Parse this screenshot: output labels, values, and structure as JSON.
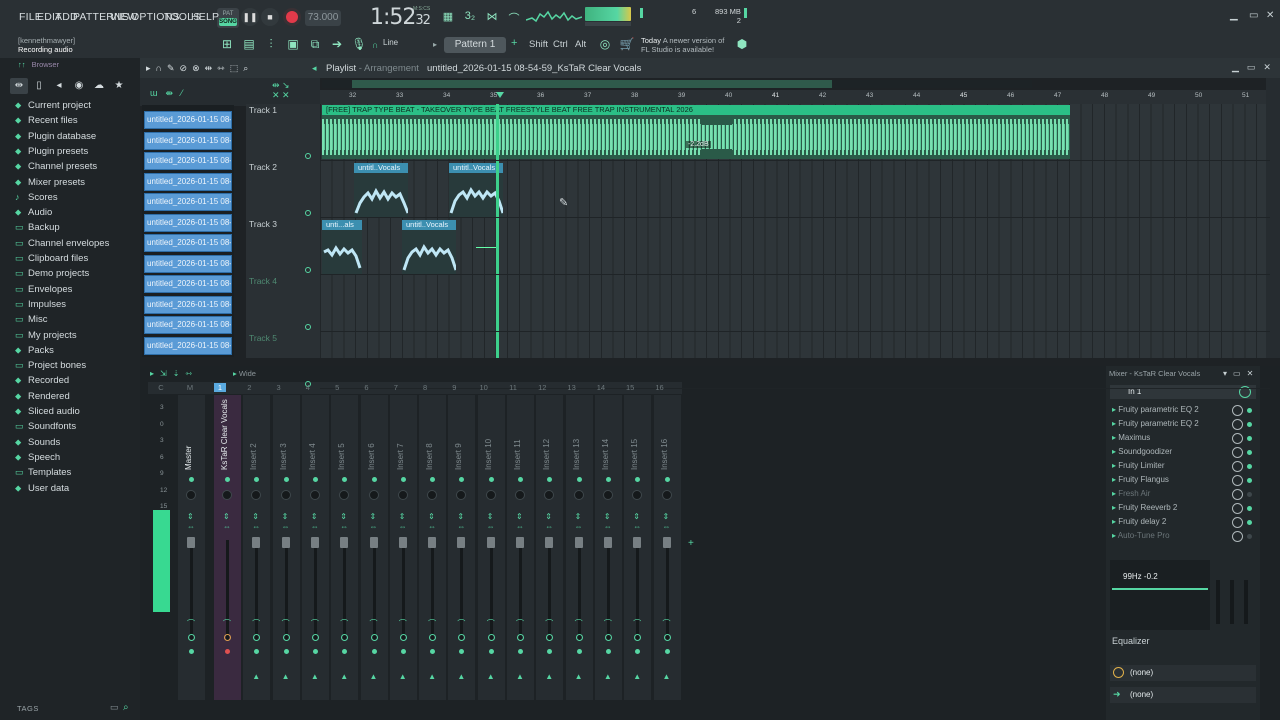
{
  "menu": [
    "FILE",
    "EDIT",
    "ADD",
    "PATTERNS",
    "VIEW",
    "OPTIONS",
    "TOOLS",
    "HELP"
  ],
  "transport": {
    "pat": "PAT",
    "song": "SONG",
    "tempo": "73.000",
    "time": "1:52",
    "time_small": "32",
    "time_unit": "M:S:CS"
  },
  "perf": {
    "cpu": "6",
    "mem": "893 MB",
    "voices": "2"
  },
  "hint": {
    "user": "[kennethmawyer]",
    "text": "Recording audio"
  },
  "snap": "Line",
  "pattern": "Pattern 1",
  "modifiers": [
    "Shift",
    "Ctrl",
    "Alt"
  ],
  "news": {
    "date": "Today",
    "text1": "A newer version of",
    "text2": "FL Studio is available!"
  },
  "browser": {
    "title": "Browser",
    "items": [
      {
        "icon": "home-icon",
        "glyph": "⬥",
        "label": "Current project"
      },
      {
        "icon": "clock-icon",
        "glyph": "⬥",
        "label": "Recent files"
      },
      {
        "icon": "plugin-icon",
        "glyph": "⬥",
        "label": "Plugin database"
      },
      {
        "icon": "plugin-icon",
        "glyph": "⬥",
        "label": "Plugin presets"
      },
      {
        "icon": "plugin-icon",
        "glyph": "⬥",
        "label": "Channel presets"
      },
      {
        "icon": "mixer-icon",
        "glyph": "⬥",
        "label": "Mixer presets"
      },
      {
        "icon": "note-icon",
        "glyph": "♪",
        "label": "Scores"
      },
      {
        "icon": "audio-icon",
        "glyph": "⬥",
        "label": "Audio"
      },
      {
        "icon": "folder-icon",
        "glyph": "▭",
        "label": "Backup"
      },
      {
        "icon": "folder-icon",
        "glyph": "▭",
        "label": "Channel envelopes"
      },
      {
        "icon": "folder-icon",
        "glyph": "▭",
        "label": "Clipboard files"
      },
      {
        "icon": "folder-icon",
        "glyph": "▭",
        "label": "Demo projects"
      },
      {
        "icon": "folder-icon",
        "glyph": "▭",
        "label": "Envelopes"
      },
      {
        "icon": "folder-icon",
        "glyph": "▭",
        "label": "Impulses"
      },
      {
        "icon": "folder-icon",
        "glyph": "▭",
        "label": "Misc"
      },
      {
        "icon": "folder-icon",
        "glyph": "▭",
        "label": "My projects"
      },
      {
        "icon": "packs-icon",
        "glyph": "⬥",
        "label": "Packs"
      },
      {
        "icon": "folder-icon",
        "glyph": "▭",
        "label": "Project bones"
      },
      {
        "icon": "recorded-icon",
        "glyph": "⬥",
        "label": "Recorded"
      },
      {
        "icon": "rendered-icon",
        "glyph": "⬥",
        "label": "Rendered"
      },
      {
        "icon": "sliced-icon",
        "glyph": "⬥",
        "label": "Sliced audio"
      },
      {
        "icon": "folder-icon",
        "glyph": "▭",
        "label": "Soundfonts"
      },
      {
        "icon": "sounds-icon",
        "glyph": "⬥",
        "label": "Sounds"
      },
      {
        "icon": "speech-icon",
        "glyph": "⬥",
        "label": "Speech"
      },
      {
        "icon": "folder-icon",
        "glyph": "▭",
        "label": "Templates"
      },
      {
        "icon": "userdata-icon",
        "glyph": "⬥",
        "label": "User data"
      }
    ],
    "tags": "TAGS"
  },
  "playlist": {
    "title": "Playlist",
    "sub": "Arrangement",
    "file": "untitled_2026-01-15 08-54-59_KsTaR Clear Vocals",
    "ruler": [
      "32",
      "33",
      "34",
      "35",
      "36",
      "37",
      "38",
      "39",
      "40",
      "41",
      "42",
      "43",
      "44",
      "45",
      "46",
      "47",
      "48",
      "49",
      "50",
      "51"
    ],
    "picker": [
      "untitled_2026-01-15 08-",
      "untitled_2026-01-15 08-",
      "untitled_2026-01-15 08-",
      "untitled_2026-01-15 08-",
      "untitled_2026-01-15 08-",
      "untitled_2026-01-15 08-",
      "untitled_2026-01-15 08-",
      "untitled_2026-01-15 08-",
      "untitled_2026-01-15 08-",
      "untitled_2026-01-15 08-",
      "untitled_2026-01-15 08-",
      "untitled_2026-01-15 08-"
    ],
    "tracks": [
      "Track 1",
      "Track 2",
      "Track 3",
      "Track 4",
      "Track 5"
    ],
    "clips": {
      "beat": "[FREE] TRAP TYPE BEAT - TAKEOVER  TYPE BEAT  FREESTYLE BEAT  FREE TRAP INSTRUMENTAL 2026",
      "c1": "untitl..Vocals",
      "c2": "untitl..Vocals",
      "c3": "unti...als",
      "c4": "untitl..Vocals"
    },
    "db": "-2.2dB"
  },
  "mixer": {
    "mode": "Wide",
    "numbers": [
      "C",
      "M",
      "1",
      "2",
      "3",
      "4",
      "5",
      "6",
      "7",
      "8",
      "9",
      "10",
      "11",
      "12",
      "13",
      "14",
      "15",
      "16"
    ],
    "strips": [
      "Master",
      "KsTaR Clear Vocals",
      "Insert 2",
      "Insert 3",
      "Insert 4",
      "Insert 5",
      "Insert 6",
      "Insert 7",
      "Insert 8",
      "Insert 9",
      "Insert 10",
      "Insert 11",
      "Insert 12",
      "Insert 13",
      "Insert 14",
      "Insert 15",
      "Insert 16"
    ],
    "db_scale": [
      "3",
      "0",
      "3",
      "6",
      "9",
      "12",
      "15"
    ]
  },
  "mixer_panel": {
    "title": "Mixer - KsTaR Clear Vocals",
    "input": "In 1",
    "slots": [
      {
        "name": "Fruity parametric EQ 2",
        "dim": false
      },
      {
        "name": "Fruity parametric EQ 2",
        "dim": false
      },
      {
        "name": "Maximus",
        "dim": false
      },
      {
        "name": "Soundgoodizer",
        "dim": false
      },
      {
        "name": "Fruity Limiter",
        "dim": false
      },
      {
        "name": "Fruity Flangus",
        "dim": false
      },
      {
        "name": "Fresh Air",
        "dim": true
      },
      {
        "name": "Fruity Reeverb 2",
        "dim": false
      },
      {
        "name": "Fruity delay 2",
        "dim": false
      },
      {
        "name": "Auto-Tune Pro",
        "dim": true
      }
    ],
    "eq_value": "99Hz -0.2",
    "eq_label": "Equalizer",
    "none1": "(none)",
    "none2": "(none)"
  }
}
